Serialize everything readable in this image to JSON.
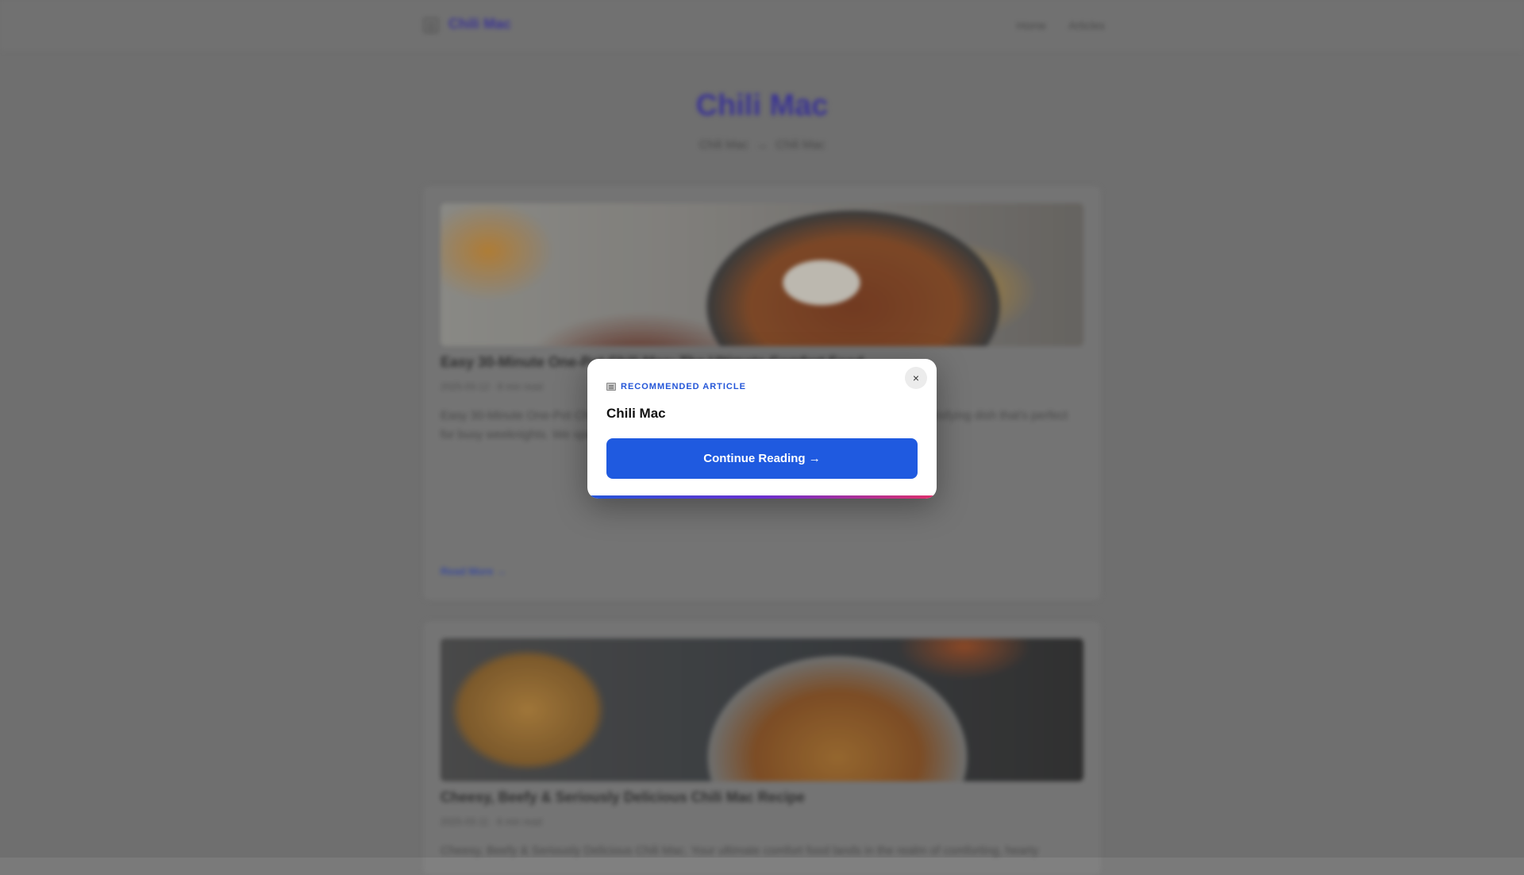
{
  "header": {
    "site_name": "Chili Mac",
    "nav": [
      "Home",
      "Articles"
    ]
  },
  "hero": {
    "title": "Chili Mac",
    "breadcrumb": [
      "Chili Mac",
      "→",
      "Chili Mac"
    ]
  },
  "articles": [
    {
      "title": "Easy 30-Minute One-Pot Chili Mac: The Ultimate Comfort Food",
      "meta": "2025-03-12 · 8 min read",
      "excerpt": "Easy 30-Minute One-Pot Chili Mac combines the best of two comfort food classics into one satisfying dish that's perfect for busy weeknights. We spend for a satisfying, speedy, and delicious family dinner.",
      "read_more": "Read More →"
    },
    {
      "title": "Cheesy, Beefy & Seriously Delicious Chili Mac Recipe",
      "meta": "2025-03-11 · 6 min read",
      "excerpt": "Cheesy, Beefy & Seriously Delicious Chili Mac. Your ultimate comfort food lands in the realm of comforting, hearty"
    }
  ],
  "modal": {
    "eyebrow": "RECOMMENDED ARTICLE",
    "eyebrow_icon": "newspaper-icon",
    "title": "Chili Mac",
    "cta_label": "Continue Reading →",
    "close_label": "×",
    "accent_color": "#1f5ae0"
  }
}
